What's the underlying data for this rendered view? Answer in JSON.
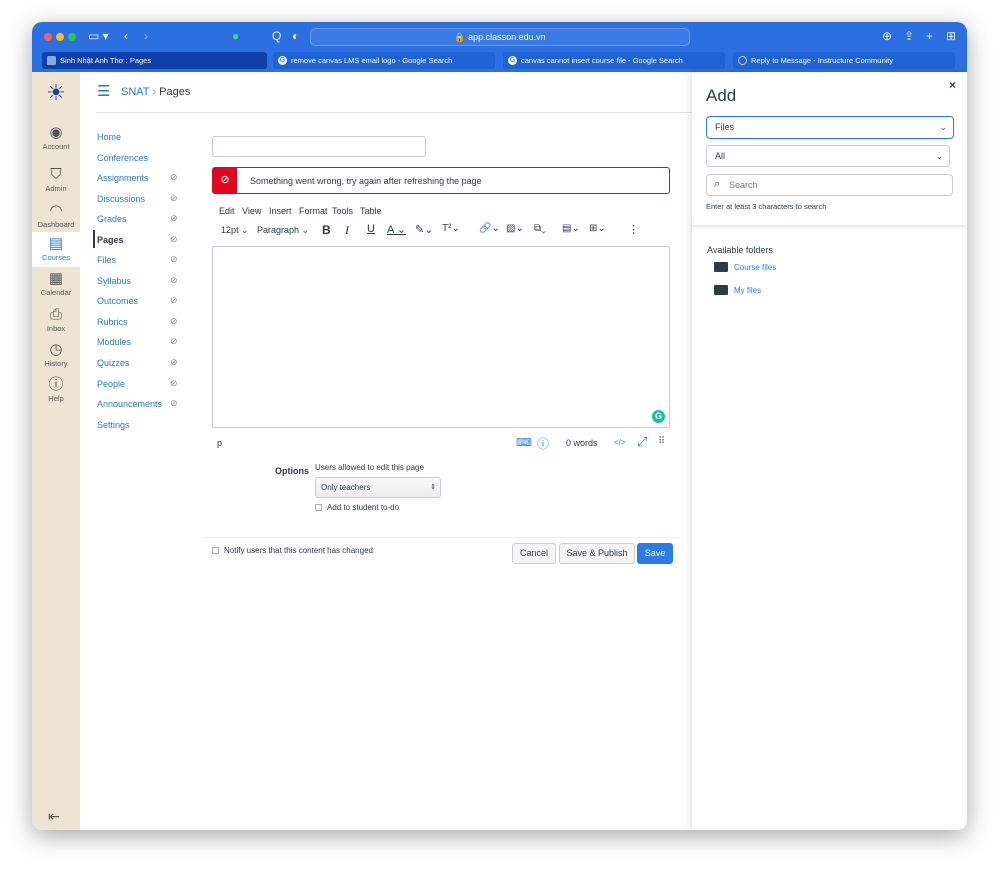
{
  "browser": {
    "url": "app.classon.edu.vn",
    "tabs": [
      {
        "label": "Sinh Nhật Anh Thơ : Pages",
        "active": true
      },
      {
        "label": "remove canvas LMS email logo - Google Search"
      },
      {
        "label": "canvas cannot insert course file - Google Search"
      },
      {
        "label": "Reply to Message - Instructure Community"
      }
    ]
  },
  "global_nav": [
    {
      "label": "Account",
      "icon": "account-icon"
    },
    {
      "label": "Admin",
      "icon": "shield-icon"
    },
    {
      "label": "Dashboard",
      "icon": "dashboard-icon"
    },
    {
      "label": "Courses",
      "icon": "courses-icon",
      "active": true
    },
    {
      "label": "Calendar",
      "icon": "calendar-icon"
    },
    {
      "label": "Inbox",
      "icon": "inbox-icon"
    },
    {
      "label": "History",
      "icon": "clock-icon"
    },
    {
      "label": "Help",
      "icon": "help-icon"
    }
  ],
  "breadcrumb": {
    "course": "SNAT",
    "page": "Pages"
  },
  "course_nav": [
    {
      "label": "Home"
    },
    {
      "label": "Conferences"
    },
    {
      "label": "Assignments",
      "hidden": true
    },
    {
      "label": "Discussions",
      "hidden": true
    },
    {
      "label": "Grades",
      "hidden": true
    },
    {
      "label": "Pages",
      "hidden": true,
      "active": true
    },
    {
      "label": "Files",
      "hidden": true
    },
    {
      "label": "Syllabus",
      "hidden": true
    },
    {
      "label": "Outcomes",
      "hidden": true
    },
    {
      "label": "Rubrics",
      "hidden": true
    },
    {
      "label": "Modules",
      "hidden": true
    },
    {
      "label": "Quizzes",
      "hidden": true
    },
    {
      "label": "People",
      "hidden": true
    },
    {
      "label": "Announcements",
      "hidden": true
    },
    {
      "label": "Settings"
    }
  ],
  "editor": {
    "title_value": "",
    "error": "Something went wrong, try again after refreshing the page",
    "menus": [
      "Edit",
      "View",
      "Insert",
      "Format",
      "Tools",
      "Table"
    ],
    "font_size": "12pt",
    "block": "Paragraph",
    "status_path": "p",
    "word_count": "0 words",
    "html_toggle": "</>"
  },
  "options": {
    "label": "Options",
    "edit_label": "Users allowed to edit this page",
    "edit_value": "Only teachers",
    "todo_label": "Add to student to-do"
  },
  "footer": {
    "notify_label": "Notify users that this content has changed",
    "cancel": "Cancel",
    "save_publish": "Save & Publish",
    "save": "Save"
  },
  "tray": {
    "title": "Add",
    "close": "×",
    "type_value": "Files",
    "filter_value": "All",
    "search_placeholder": "Search",
    "hint": "Enter at least 3 characters to search",
    "folders_heading": "Available folders",
    "folders": [
      "Course files",
      "My files"
    ]
  },
  "colors": {
    "browser": "#2c6fe0",
    "link": "#2b7abc",
    "error": "#e0061f",
    "primary": "#2b7ce9",
    "nav_bg": "#ede4d3"
  }
}
